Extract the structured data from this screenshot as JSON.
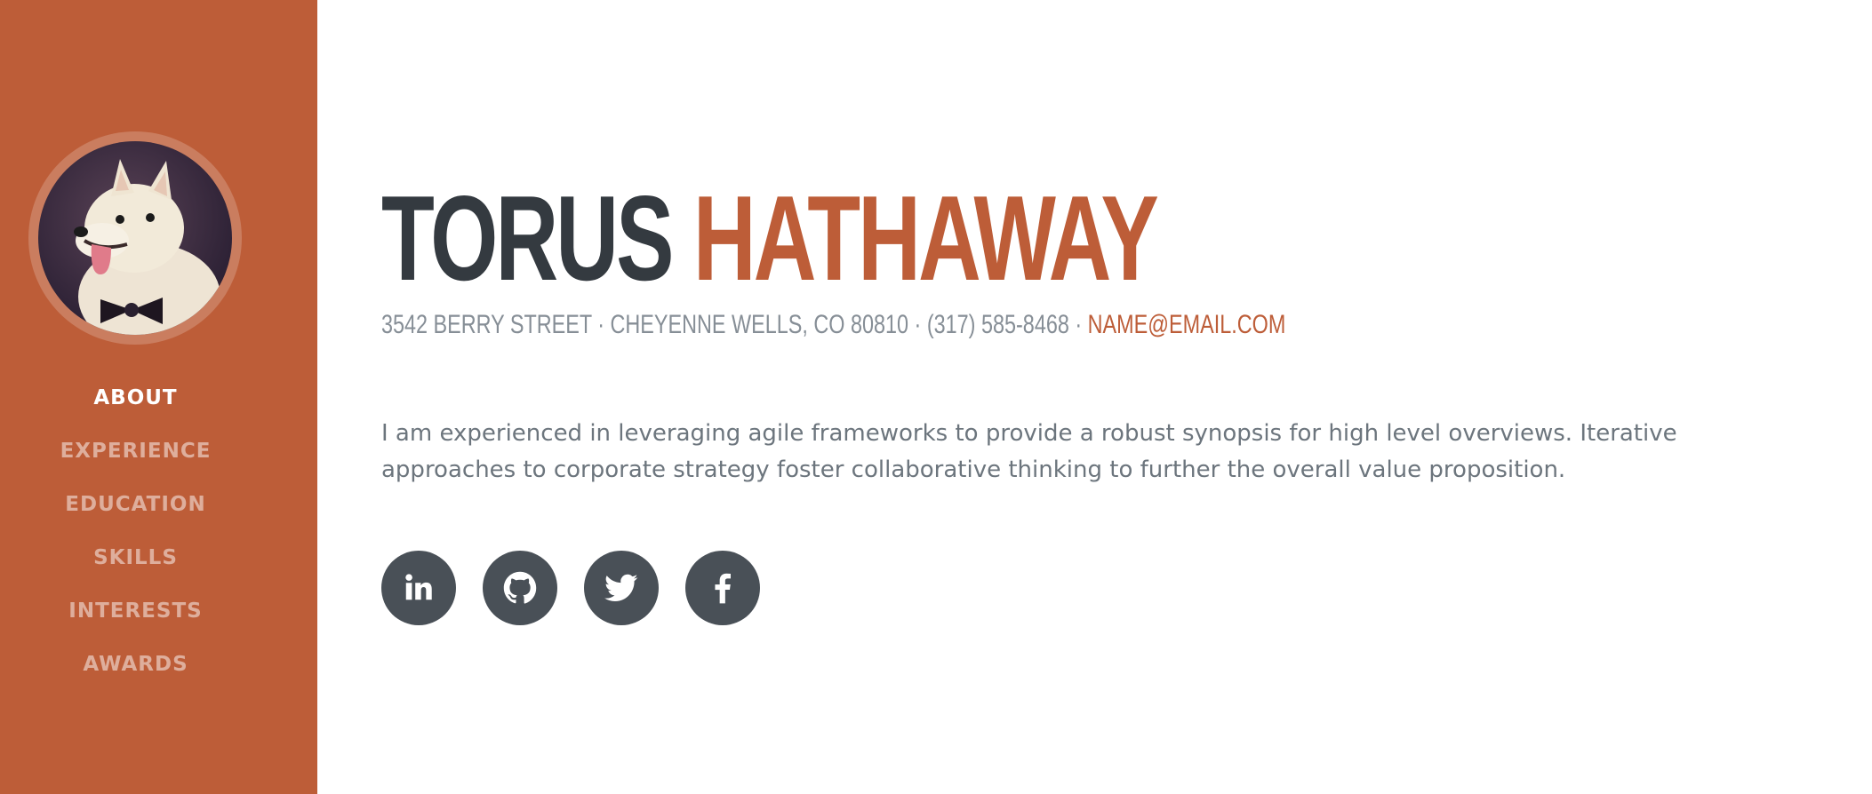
{
  "sidebar": {
    "bg_color": "#bd5d38",
    "avatar": "dog-profile-photo",
    "nav": [
      {
        "label": "ABOUT",
        "active": true
      },
      {
        "label": "EXPERIENCE",
        "active": false
      },
      {
        "label": "EDUCATION",
        "active": false
      },
      {
        "label": "SKILLS",
        "active": false
      },
      {
        "label": "INTERESTS",
        "active": false
      },
      {
        "label": "AWARDS",
        "active": false
      }
    ]
  },
  "about": {
    "first_name": "TORUS",
    "last_name": "HATHAWAY",
    "address": "3542 BERRY STREET · CHEYENNE WELLS, CO 80810 · (317) 585-8468 · ",
    "email": "NAME@EMAIL.COM",
    "lead": "I am experienced in leveraging agile frameworks to provide a robust synopsis for high level overviews. Iterative approaches to corporate strategy foster collaborative thinking to further the overall value proposition.",
    "accent_color": "#bd5d38",
    "social": [
      "linkedin-icon",
      "github-icon",
      "twitter-icon",
      "facebook-icon"
    ]
  }
}
